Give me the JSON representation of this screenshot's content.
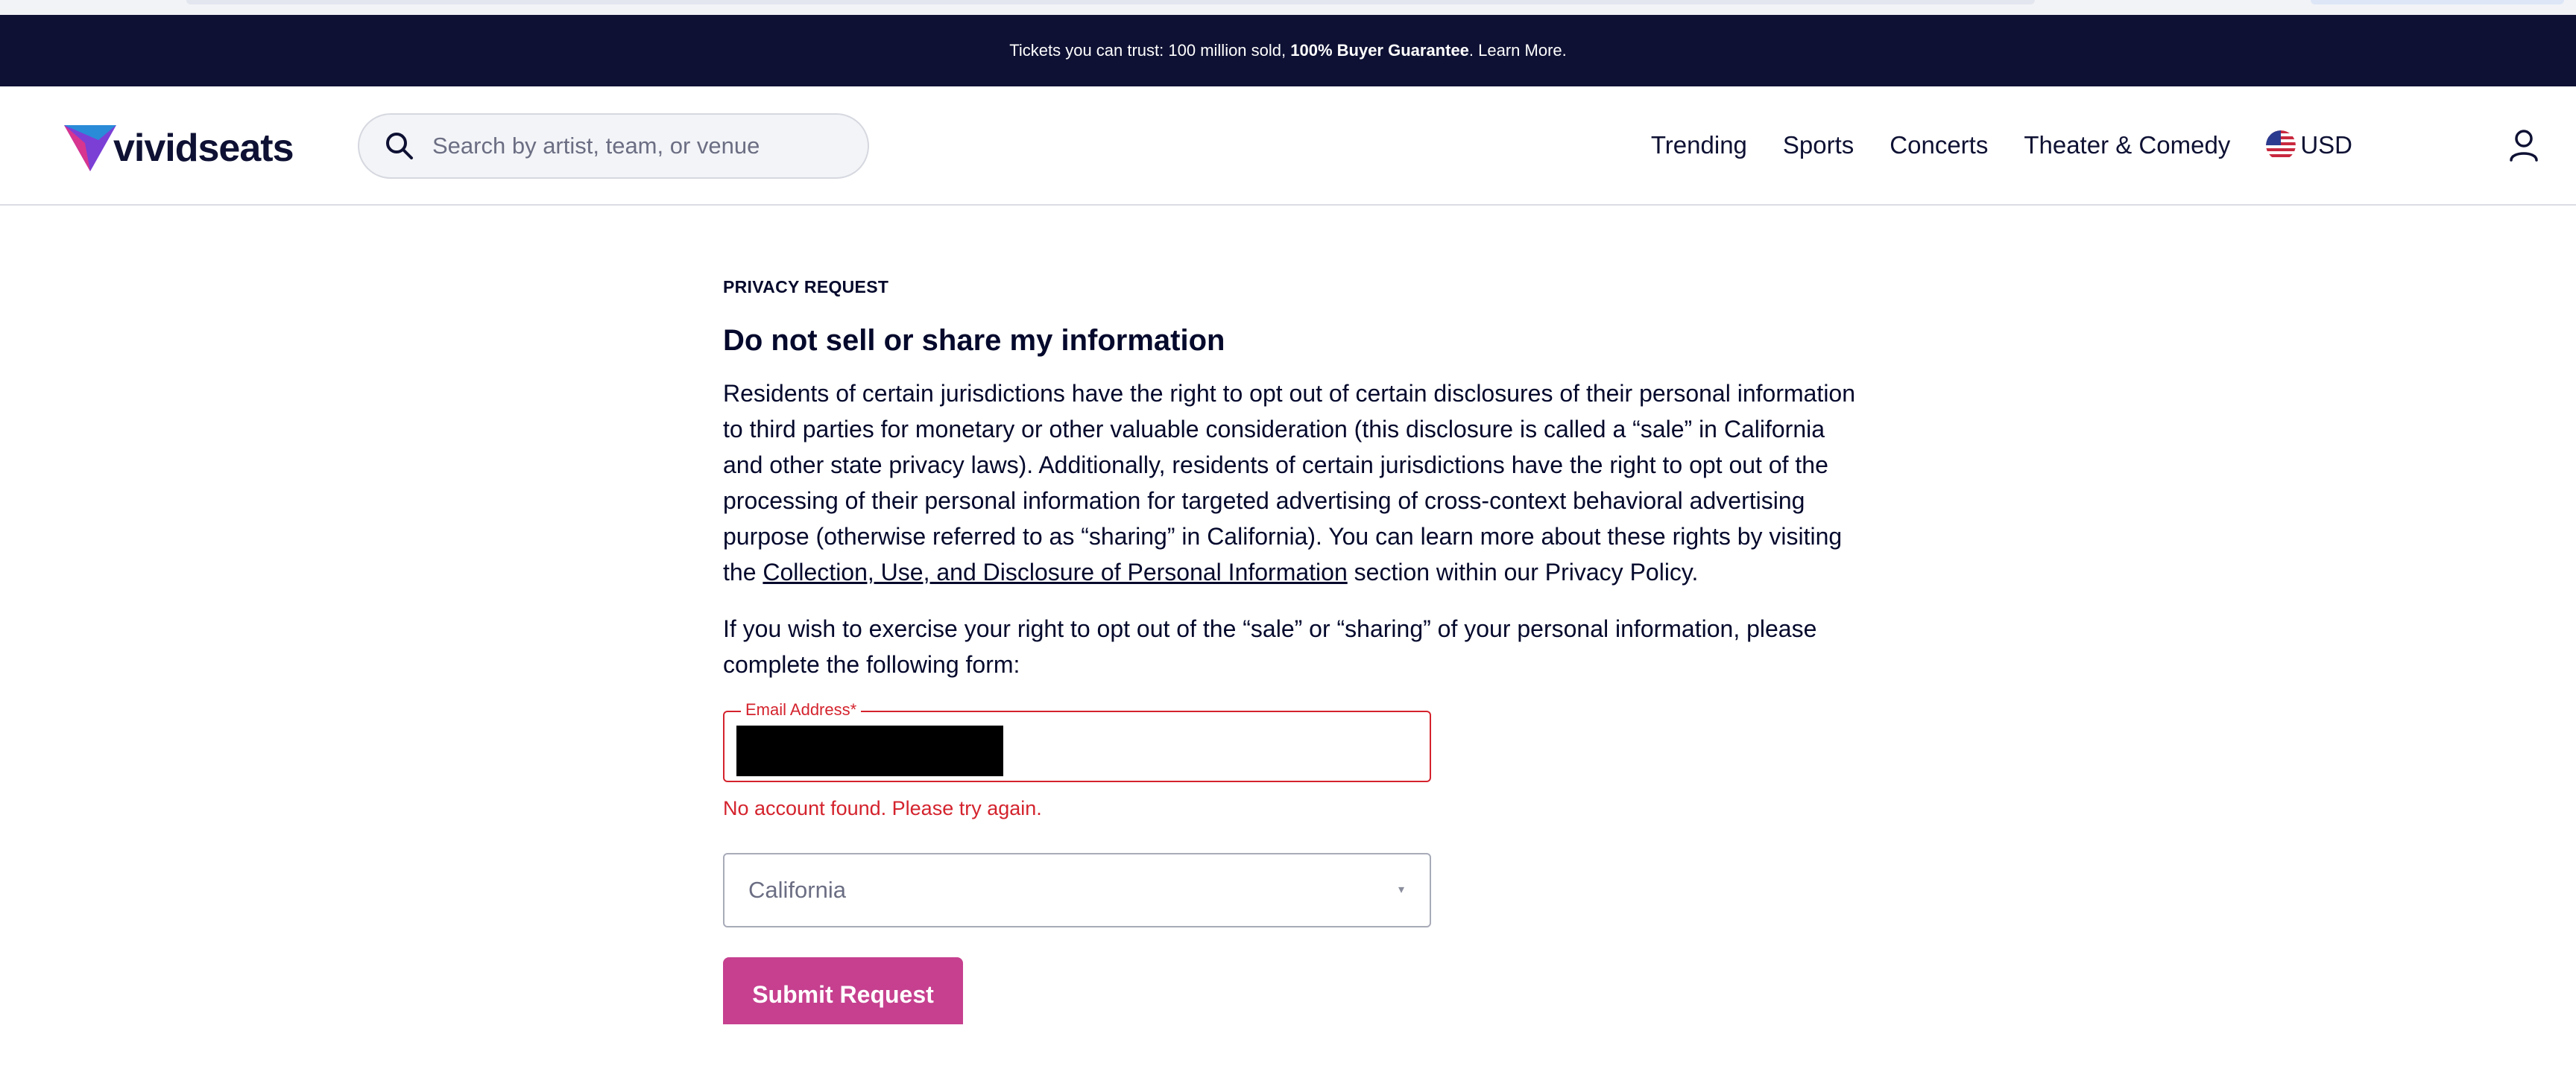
{
  "announcement": {
    "prefix": "Tickets you can trust: 100 million sold, ",
    "bold": "100% Buyer Guarantee",
    "suffix": ". Learn More."
  },
  "header": {
    "logo_text": "vividseats",
    "search_placeholder": "Search by artist, team, or venue",
    "nav": [
      "Trending",
      "Sports",
      "Concerts",
      "Theater & Comedy"
    ],
    "currency": "USD"
  },
  "main": {
    "eyebrow": "PRIVACY REQUEST",
    "title": "Do not sell or share my information",
    "para1_before_link": "Residents of certain jurisdictions have the right to opt out of certain disclosures of their personal information to third parties for monetary or other valuable consideration (this disclosure is called a “sale” in California and other state privacy laws). Additionally, residents of certain jurisdictions have the right to opt out of the processing of their personal information for targeted advertising of cross-context behavioral advertising purpose (otherwise referred to as “sharing” in California). You can learn more about these rights by visiting the ",
    "para1_link": "Collection, Use, and Disclosure of Personal Information",
    "para1_after_link": " section within our Privacy Policy.",
    "para2": "If you wish to exercise your right to opt out of the “sale” or “sharing” of your personal information, please complete the following form:",
    "email_label": "Email Address*",
    "error": "No account found. Please try again.",
    "state_value": "California",
    "submit_label": "Submit Request"
  },
  "colors": {
    "announce_bg": "#0e1133",
    "error": "#d4232d",
    "submit": "#c6408f"
  }
}
